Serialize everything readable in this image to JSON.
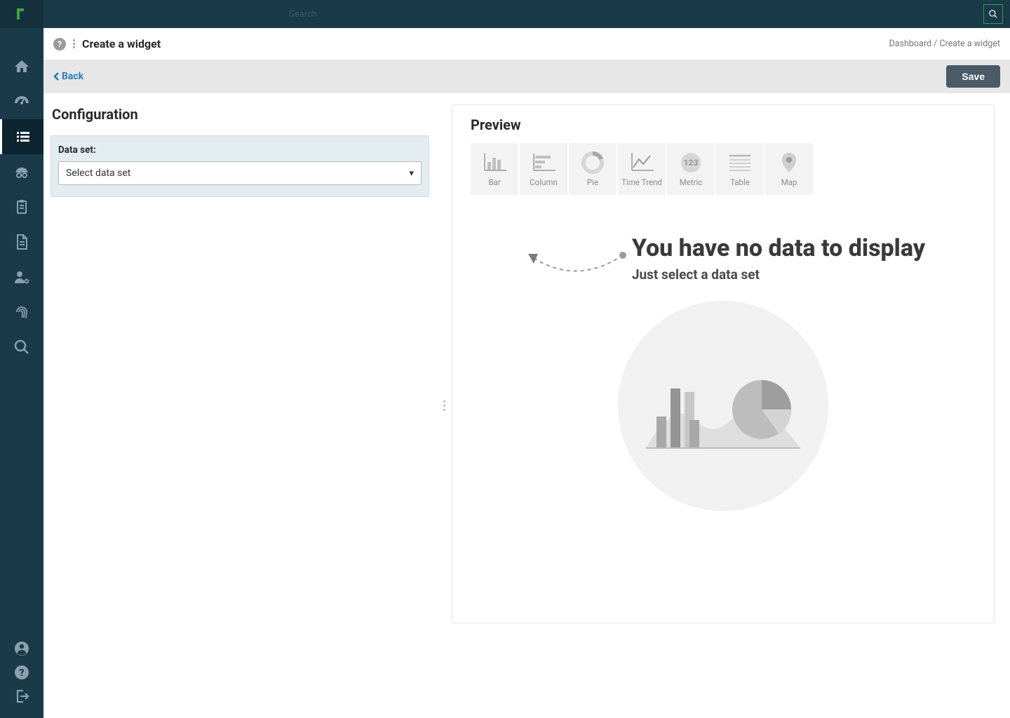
{
  "topbar": {
    "center_text": "Search"
  },
  "page": {
    "title": "Create a widget",
    "breadcrumb": "Dashboard / Create a widget"
  },
  "action_bar": {
    "back_label": "Back",
    "save_label": "Save"
  },
  "configuration": {
    "heading": "Configuration",
    "data_set_label": "Data set:",
    "select_placeholder": "Select data set"
  },
  "preview": {
    "heading": "Preview",
    "empty_title": "You have no data to display",
    "empty_subtitle": "Just select a data set"
  },
  "chart_types": {
    "bar": "Bar",
    "column": "Column",
    "pie": "Pie",
    "time_trend": "Time Trend",
    "metric": "Metric",
    "table": "Table",
    "map": "Map"
  }
}
